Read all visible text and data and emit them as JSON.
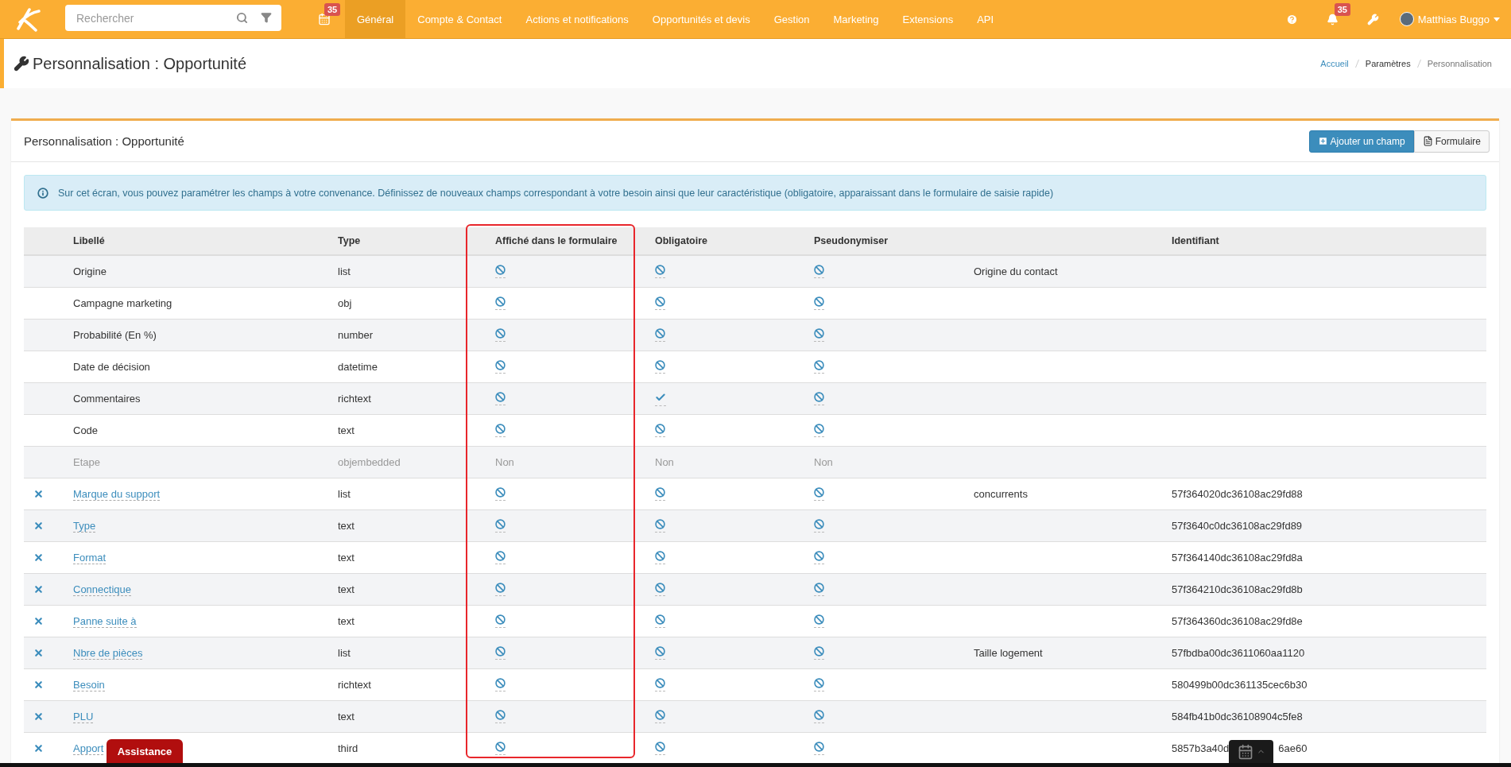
{
  "nav": {
    "search": {
      "placeholder": "Rechercher"
    },
    "calendar_badge": "35",
    "menu": [
      {
        "label": "Général",
        "selected": true
      },
      {
        "label": "Compte & Contact",
        "selected": false
      },
      {
        "label": "Actions et notifications",
        "selected": false
      },
      {
        "label": "Opportunités et devis",
        "selected": false
      },
      {
        "label": "Gestion",
        "selected": false
      },
      {
        "label": "Marketing",
        "selected": false
      },
      {
        "label": "Extensions",
        "selected": false
      },
      {
        "label": "API",
        "selected": false
      }
    ],
    "notifications_badge": "35",
    "user": "Matthias Buggo"
  },
  "page_header": {
    "title": "Personnalisation : Opportunité",
    "breadcrumb": [
      {
        "label": "Accueil",
        "kind": "link"
      },
      {
        "label": "Paramètres",
        "kind": "section"
      },
      {
        "label": "Personnalisation",
        "kind": "current"
      }
    ]
  },
  "card": {
    "title": "Personnalisation : Opportunité",
    "buttons": [
      {
        "label": "Ajouter un champ",
        "kind": "primary"
      },
      {
        "label": "Formulaire",
        "kind": "default"
      }
    ],
    "info": "Sur cet écran, vous pouvez paramétrer les champs à votre convenance. Définissez de nouveaux champs correspondant à votre besoin ainsi que leur caractéristique (obligatoire, apparaissant dans le formulaire de saisie rapide)",
    "columns": {
      "label": "Libellé",
      "type": "Type",
      "displayed": "Affiché dans le formulaire",
      "required": "Obligatoire",
      "pseudonymised": "Pseudonymiser",
      "identifier": "Identifiant"
    },
    "annotation": {
      "kind": "frame"
    },
    "rows": [
      {
        "label": "Origine",
        "type": "list",
        "deletable": false,
        "link": false,
        "disabled": false,
        "displayed": {
          "on": false
        },
        "required": {
          "on": false
        },
        "pseudonymised": {
          "on": false
        },
        "column_6": "Origine du contact"
      },
      {
        "label": "Campagne marketing",
        "type": "obj",
        "deletable": false,
        "link": false,
        "disabled": false,
        "displayed": {
          "on": false
        },
        "required": {
          "on": false
        },
        "pseudonymised": {
          "on": false
        }
      },
      {
        "label": "Probabilité (En %)",
        "type": "number",
        "deletable": false,
        "link": false,
        "disabled": false,
        "displayed": {
          "on": false
        },
        "required": {
          "on": false
        },
        "pseudonymised": {
          "on": false
        }
      },
      {
        "label": "Date de décision",
        "type": "datetime",
        "deletable": false,
        "link": false,
        "disabled": false,
        "displayed": {
          "on": false
        },
        "required": {
          "on": false
        },
        "pseudonymised": {
          "on": false
        }
      },
      {
        "label": "Commentaires",
        "type": "richtext",
        "deletable": false,
        "link": false,
        "disabled": false,
        "displayed": {
          "on": false
        },
        "required": {
          "on": true
        },
        "pseudonymised": {
          "on": false
        }
      },
      {
        "label": "Code",
        "type": "text",
        "deletable": false,
        "link": false,
        "disabled": false,
        "displayed": {
          "on": false
        },
        "required": {
          "on": false
        },
        "pseudonymised": {
          "on": false
        }
      },
      {
        "label": "Etape",
        "type": "objembedded",
        "deletable": false,
        "link": false,
        "disabled": true,
        "displayed": {
          "text": "Non"
        },
        "required": {
          "text": "Non"
        },
        "pseudonymised": {
          "text": "Non"
        }
      },
      {
        "label": "Marque du support",
        "type": "list",
        "deletable": true,
        "link": true,
        "disabled": false,
        "displayed": {
          "on": false
        },
        "required": {
          "on": false
        },
        "pseudonymised": {
          "on": false
        },
        "column_6": "concurrents",
        "identifier": "57f364020dc36108ac29fd88"
      },
      {
        "label": "Type",
        "type": "text",
        "deletable": true,
        "link": true,
        "disabled": false,
        "displayed": {
          "on": false
        },
        "required": {
          "on": false
        },
        "pseudonymised": {
          "on": false
        },
        "identifier": "57f3640c0dc36108ac29fd89"
      },
      {
        "label": "Format",
        "type": "text",
        "deletable": true,
        "link": true,
        "disabled": false,
        "displayed": {
          "on": false
        },
        "required": {
          "on": false
        },
        "pseudonymised": {
          "on": false
        },
        "identifier": "57f364140dc36108ac29fd8a"
      },
      {
        "label": "Connectique",
        "type": "text",
        "deletable": true,
        "link": true,
        "disabled": false,
        "displayed": {
          "on": false
        },
        "required": {
          "on": false
        },
        "pseudonymised": {
          "on": false
        },
        "identifier": "57f364210dc36108ac29fd8b"
      },
      {
        "label": "Panne suite à",
        "type": "text",
        "deletable": true,
        "link": true,
        "disabled": false,
        "displayed": {
          "on": false
        },
        "required": {
          "on": false
        },
        "pseudonymised": {
          "on": false
        },
        "identifier": "57f364360dc36108ac29fd8e"
      },
      {
        "label": "Nbre de pièces",
        "type": "list",
        "deletable": true,
        "link": true,
        "disabled": false,
        "displayed": {
          "on": false
        },
        "required": {
          "on": false
        },
        "pseudonymised": {
          "on": false
        },
        "column_6": "Taille logement",
        "identifier": "57fbdba00dc3611060aa1120"
      },
      {
        "label": "Besoin",
        "type": "richtext",
        "deletable": true,
        "link": true,
        "disabled": false,
        "displayed": {
          "on": false
        },
        "required": {
          "on": false
        },
        "pseudonymised": {
          "on": false
        },
        "identifier": "580499b00dc361135cec6b30"
      },
      {
        "label": "PLU",
        "type": "text",
        "deletable": true,
        "link": true,
        "disabled": false,
        "displayed": {
          "on": false
        },
        "required": {
          "on": false
        },
        "pseudonymised": {
          "on": false
        },
        "identifier": "584fb41b0dc36108904c5fe8"
      },
      {
        "label": "Apport",
        "type": "third",
        "deletable": true,
        "link": true,
        "disabled": false,
        "displayed": {
          "on": false
        },
        "required": {
          "on": false
        },
        "pseudonymised": {
          "on": false
        },
        "identifier": "5857b3a40d",
        "identifier_end": "6ae60"
      }
    ]
  },
  "assistance": {
    "label": "Assistance"
  }
}
